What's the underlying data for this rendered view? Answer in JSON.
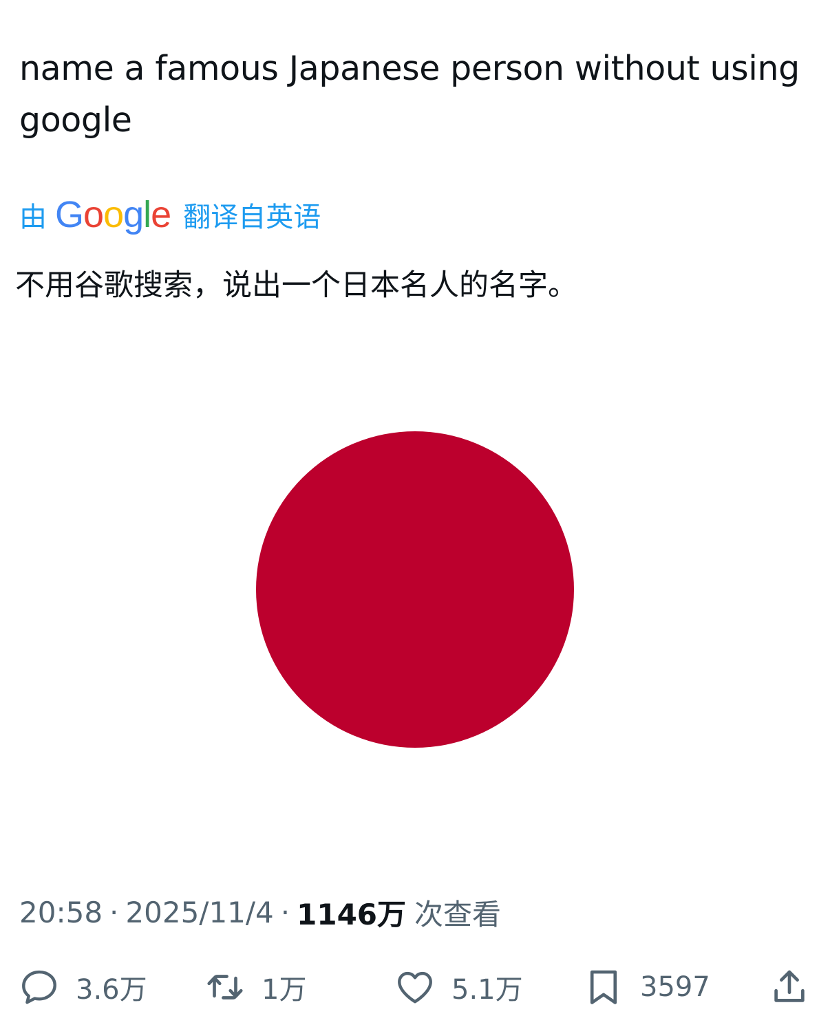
{
  "tweet": {
    "text": "name a famous Japanese person without using google",
    "translation": {
      "prefix": "由",
      "provider": "Google",
      "suffix": "翻译自英语",
      "translated_text": "不用谷歌搜索，说出一个日本名人的名字。"
    },
    "media": {
      "description_color": "#bc002d",
      "background_color": "#ffffff"
    },
    "meta": {
      "time": "20:58",
      "separator": "·",
      "date": "2025/11/4",
      "views_count": "1146万",
      "views_label": "次查看"
    },
    "actions": {
      "reply_count": "3.6万",
      "retweet_count": "1万",
      "like_count": "5.1万",
      "bookmark_count": "3597"
    }
  },
  "colors": {
    "link_blue": "#1d9bf0",
    "text_primary": "#0f1419",
    "text_secondary": "#536471",
    "google_blue": "#4285F4",
    "google_red": "#EA4335",
    "google_yellow": "#FBBC05",
    "google_green": "#34A853"
  },
  "icons": {
    "reply": "reply-bubble-icon",
    "retweet": "retweet-arrows-icon",
    "like": "heart-icon",
    "bookmark": "bookmark-icon",
    "share": "share-upload-icon"
  }
}
